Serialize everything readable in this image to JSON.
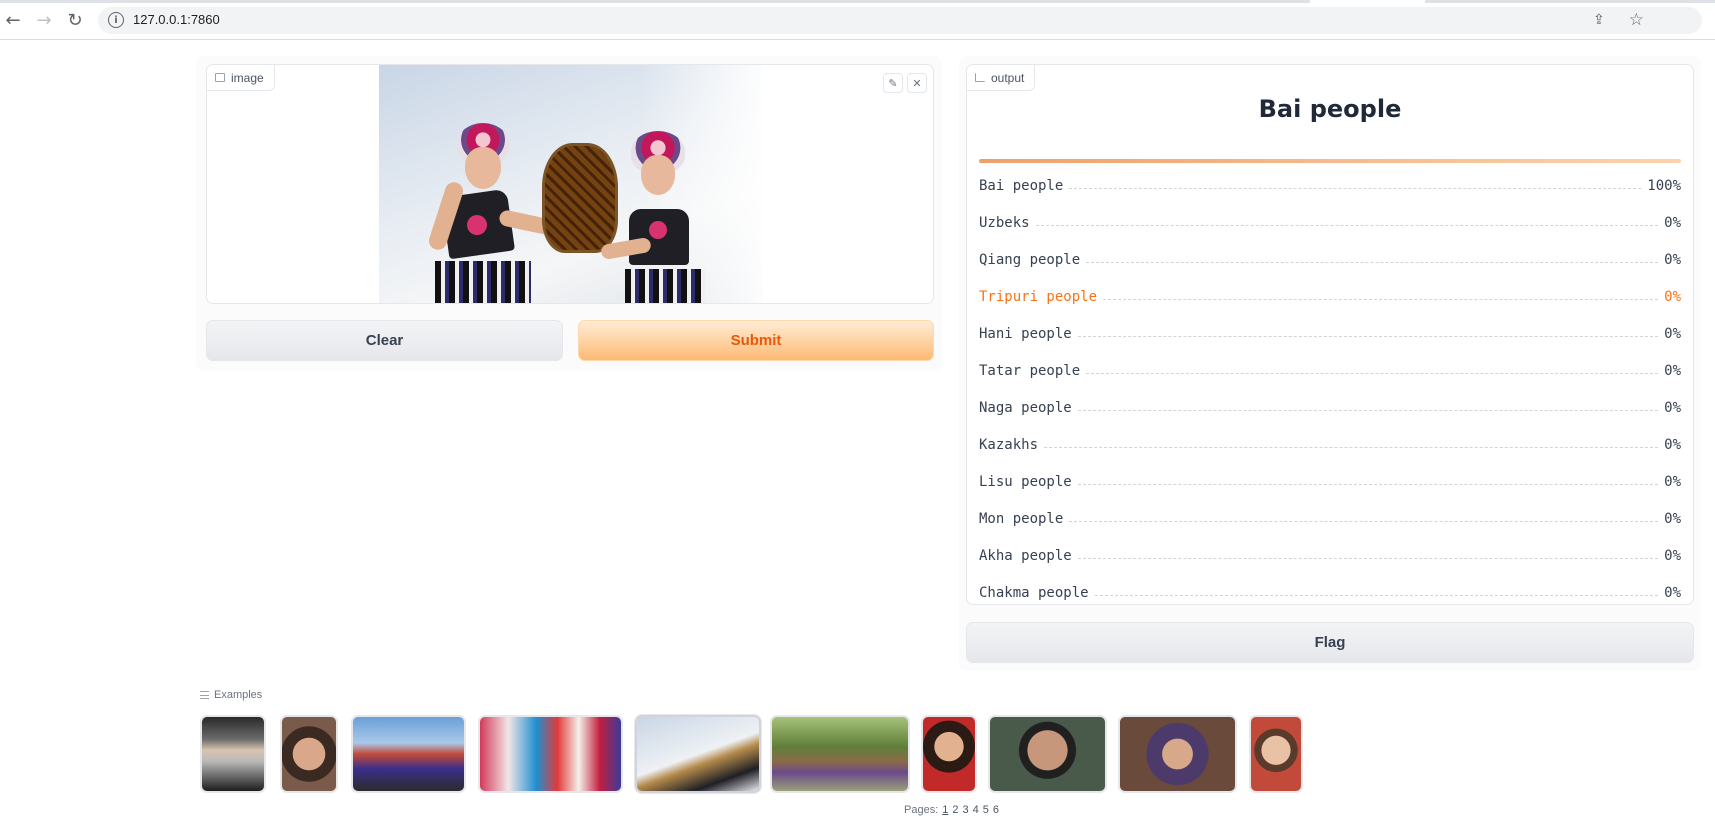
{
  "browser": {
    "url": "127.0.0.1:7860",
    "back_icon": "←",
    "forward_icon": "→",
    "reload_icon": "↻",
    "info_icon": "i",
    "share_icon": "⇪",
    "star_icon": "☆"
  },
  "input": {
    "label": "image",
    "edit_icon": "✎",
    "close_icon": "✕"
  },
  "buttons": {
    "clear": "Clear",
    "submit": "Submit",
    "flag": "Flag"
  },
  "output": {
    "label": "output",
    "top_label": "Bai people",
    "top_confidence": 1.0,
    "rows": [
      {
        "name": "Bai people",
        "pct": "100%"
      },
      {
        "name": "Uzbeks",
        "pct": "0%"
      },
      {
        "name": "Qiang people",
        "pct": "0%"
      },
      {
        "name": "Tripuri people",
        "pct": "0%"
      },
      {
        "name": "Hani people",
        "pct": "0%"
      },
      {
        "name": "Tatar people",
        "pct": "0%"
      },
      {
        "name": "Naga people",
        "pct": "0%"
      },
      {
        "name": "Kazakhs",
        "pct": "0%"
      },
      {
        "name": "Lisu people",
        "pct": "0%"
      },
      {
        "name": "Mon people",
        "pct": "0%"
      },
      {
        "name": "Akha people",
        "pct": "0%"
      },
      {
        "name": "Chakma people",
        "pct": "0%"
      }
    ]
  },
  "examples": {
    "label": "Examples",
    "pages_label": "Pages:",
    "pages": [
      "1",
      "2",
      "3",
      "4",
      "5",
      "6"
    ],
    "current_page": "1"
  },
  "colors": {
    "accent": "#f97316",
    "submit_text": "#ea580c",
    "highlight_row": "#f97316"
  }
}
